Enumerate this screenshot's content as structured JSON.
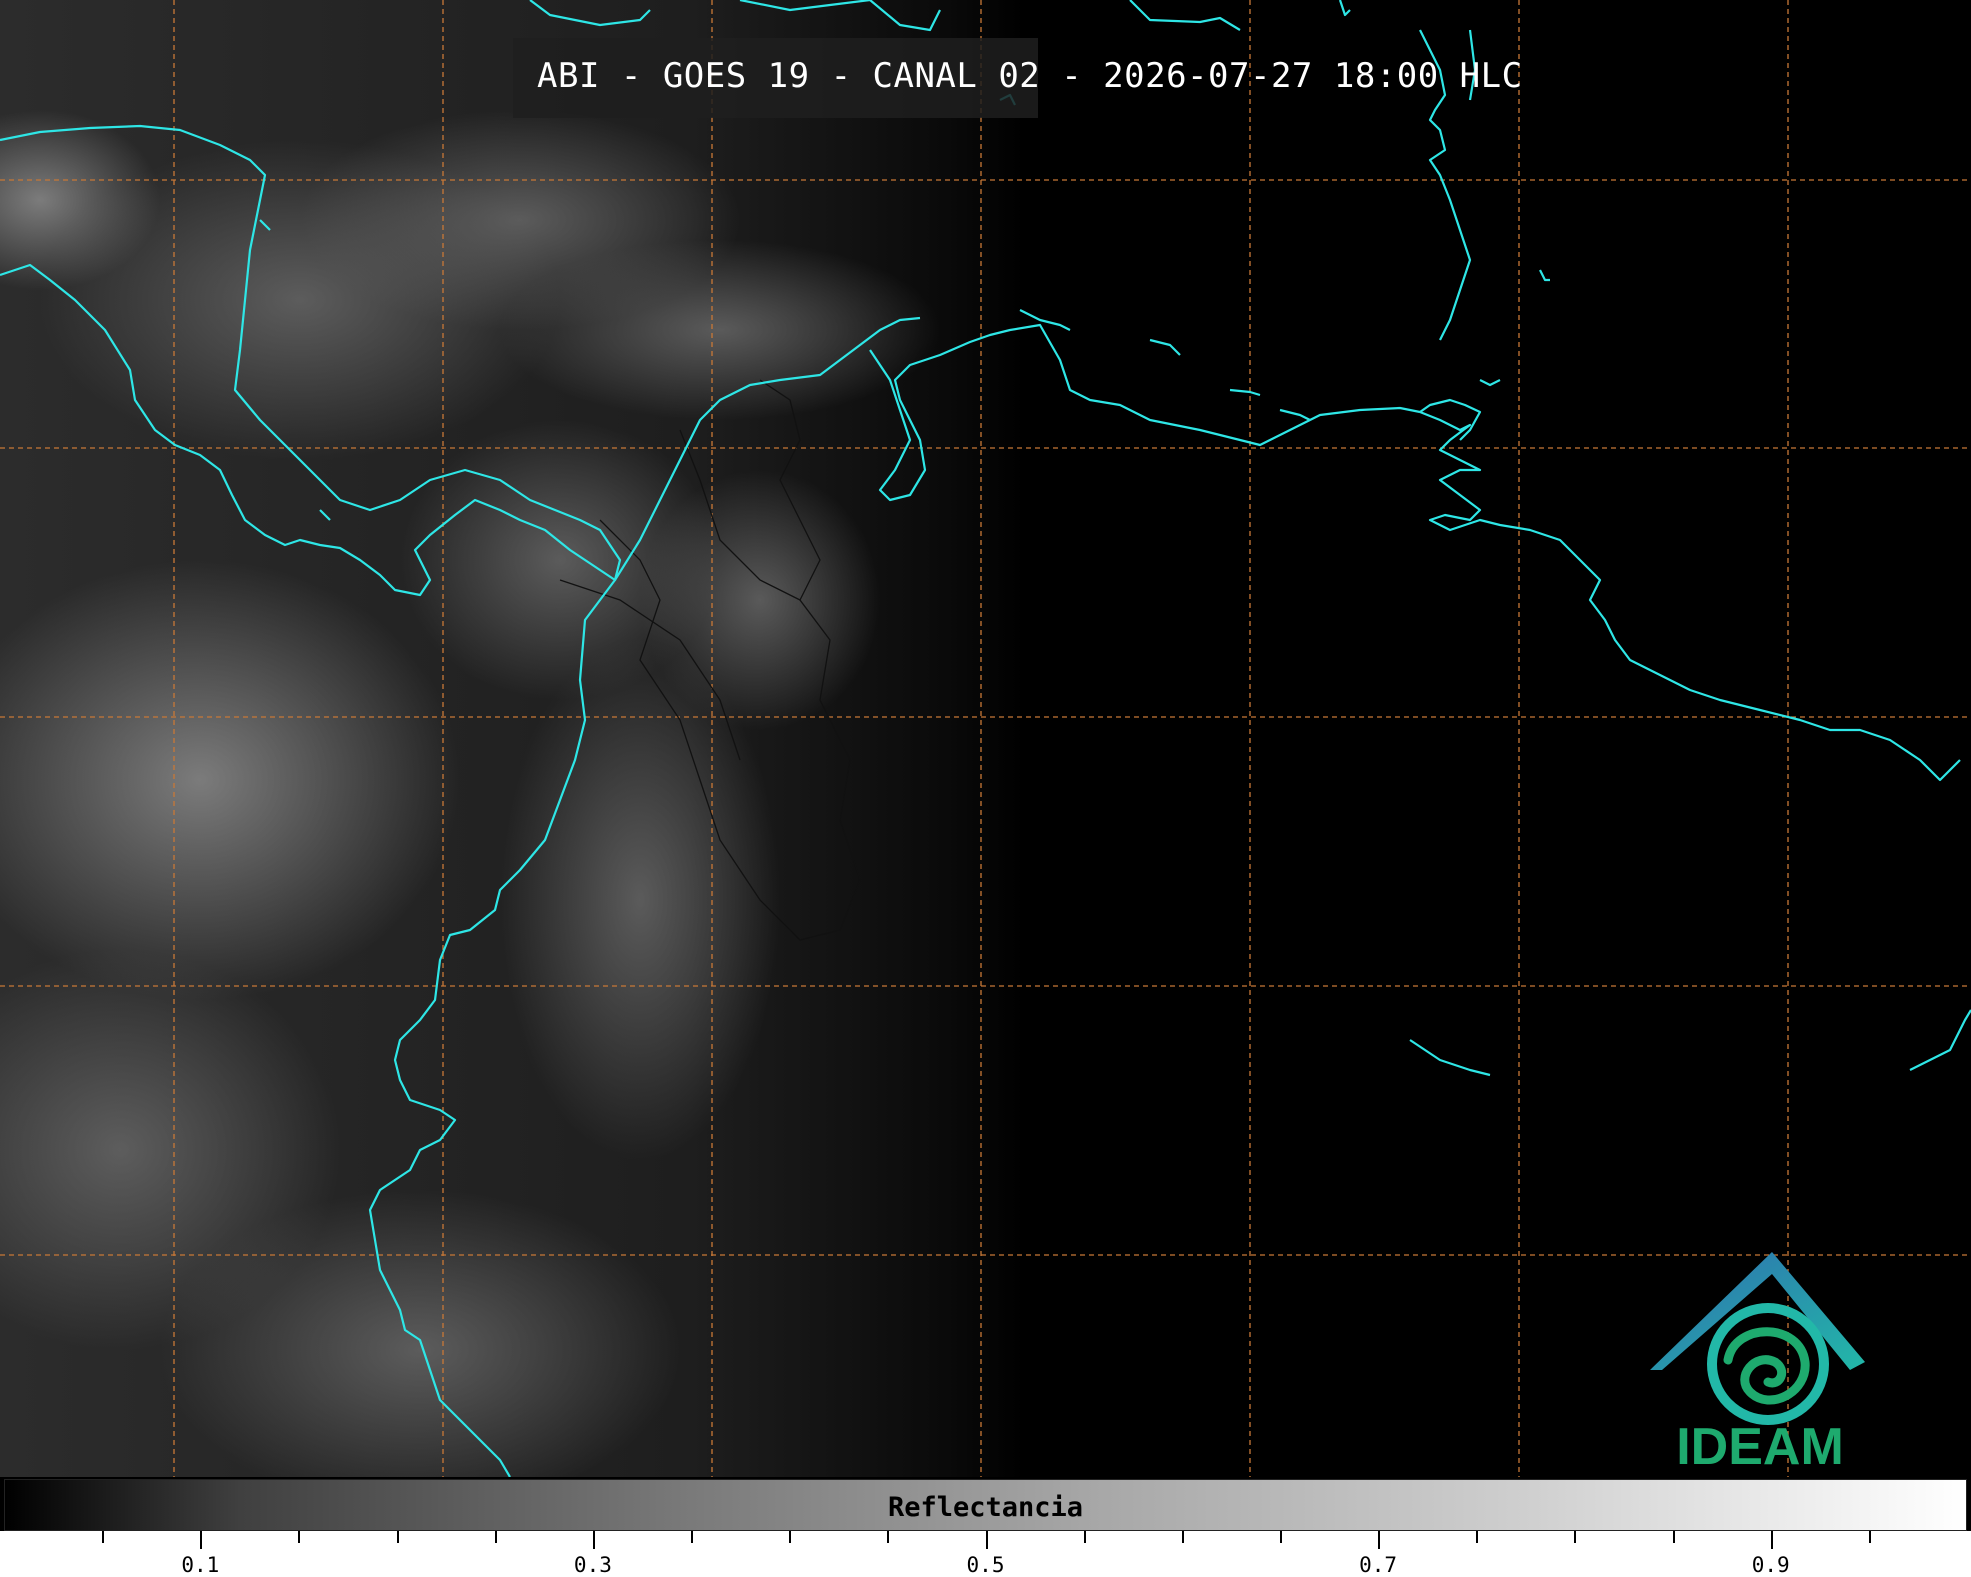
{
  "title": "ABI - GOES 19 - CANAL 02 - 2026-07-27 18:00 HLC",
  "logo_text": "IDEAM",
  "colorbar": {
    "label": "Reflectancia",
    "range": [
      0.0,
      1.0
    ],
    "major_ticks": [
      {
        "value": 0.1,
        "label": "0.1"
      },
      {
        "value": 0.3,
        "label": "0.3"
      },
      {
        "value": 0.5,
        "label": "0.5"
      },
      {
        "value": 0.7,
        "label": "0.7"
      },
      {
        "value": 0.9,
        "label": "0.9"
      }
    ],
    "minor_tick_step": 0.05
  },
  "colors": {
    "coastline": "#2ee6e6",
    "gridline": "#c87837",
    "logo_blue": "#2f6fb0",
    "logo_teal": "#22b8a8",
    "logo_green": "#1eaa6e"
  }
}
